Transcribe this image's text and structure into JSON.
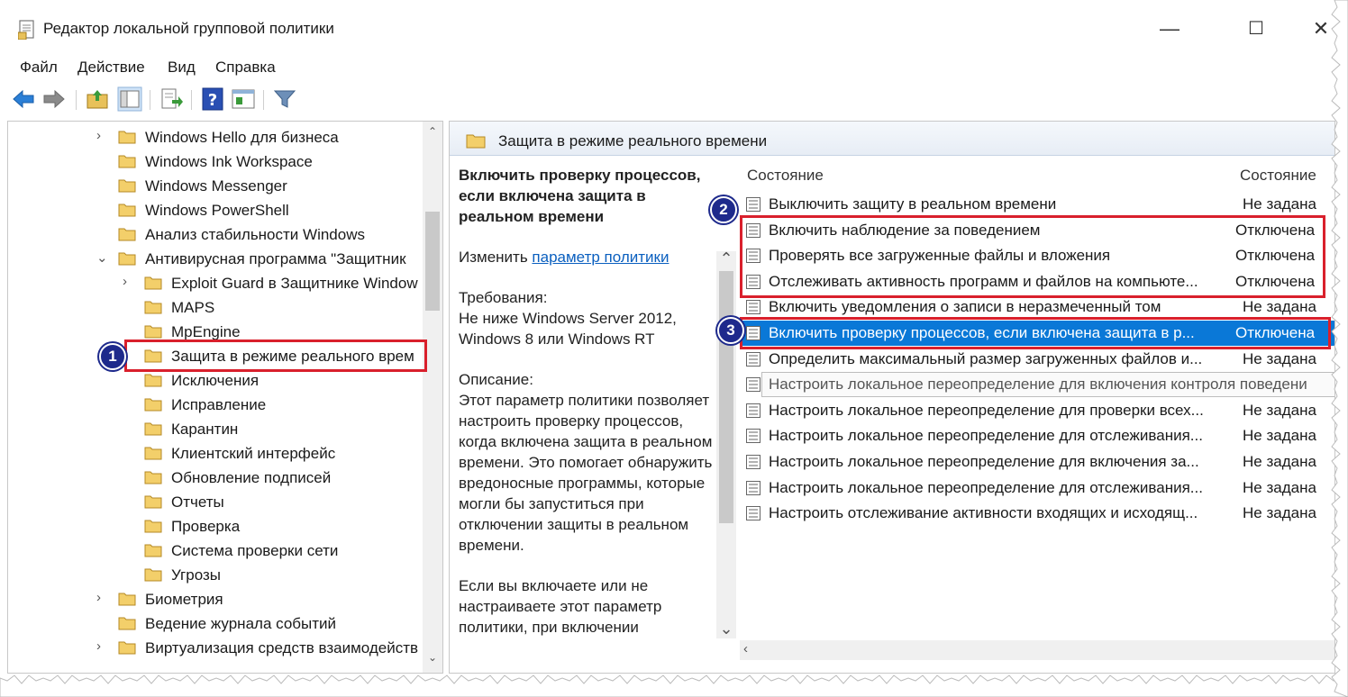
{
  "window": {
    "title": "Редактор локальной групповой политики"
  },
  "window_controls": {
    "minimize": "—",
    "maximize": "☐",
    "close": "✕"
  },
  "menu": [
    "Файл",
    "Действие",
    "Вид",
    "Справка"
  ],
  "tree": {
    "items": [
      {
        "label": "Windows Hello для бизнеса",
        "level": 0,
        "expander": "›"
      },
      {
        "label": "Windows Ink Workspace",
        "level": 0,
        "expander": ""
      },
      {
        "label": "Windows Messenger",
        "level": 0,
        "expander": ""
      },
      {
        "label": "Windows PowerShell",
        "level": 0,
        "expander": ""
      },
      {
        "label": "Анализ стабильности Windows",
        "level": 0,
        "expander": ""
      },
      {
        "label": "Антивирусная программа \"Защитник",
        "level": 0,
        "expander": "⌄"
      },
      {
        "label": "Exploit Guard в Защитнике Window",
        "level": 1,
        "expander": "›"
      },
      {
        "label": "MAPS",
        "level": 1,
        "expander": ""
      },
      {
        "label": "MpEngine",
        "level": 1,
        "expander": ""
      },
      {
        "label": "Защита в режиме реального врем",
        "level": 1,
        "expander": "",
        "selected": true
      },
      {
        "label": "Исключения",
        "level": 1,
        "expander": ""
      },
      {
        "label": "Исправление",
        "level": 1,
        "expander": ""
      },
      {
        "label": "Карантин",
        "level": 1,
        "expander": ""
      },
      {
        "label": "Клиентский интерфейс",
        "level": 1,
        "expander": ""
      },
      {
        "label": "Обновление подписей",
        "level": 1,
        "expander": ""
      },
      {
        "label": "Отчеты",
        "level": 1,
        "expander": ""
      },
      {
        "label": "Проверка",
        "level": 1,
        "expander": ""
      },
      {
        "label": "Система проверки сети",
        "level": 1,
        "expander": ""
      },
      {
        "label": "Угрозы",
        "level": 1,
        "expander": ""
      },
      {
        "label": "Биометрия",
        "level": 0,
        "expander": "›"
      },
      {
        "label": "Ведение журнала событий",
        "level": 0,
        "expander": ""
      },
      {
        "label": "Виртуализация средств взаимодейств",
        "level": 0,
        "expander": "›"
      }
    ]
  },
  "pane_header": {
    "title": "Защита в режиме реального времени"
  },
  "description": {
    "heading": "Включить проверку процессов, если включена защита в реальном времени",
    "edit_prefix": "Изменить",
    "edit_link": "параметр политики",
    "requirements_label": "Требования:",
    "requirements_text": "Не ниже Windows Server 2012, Windows 8 или Windows RT",
    "description_label": "Описание:",
    "description_text": "Этот параметр политики позволяет настроить проверку процессов, когда включена защита в реальном времени. Это помогает обнаружить вредоносные программы, которые могли бы запуститься при отключении защиты в реальном времени.",
    "extra_text": "Если вы включаете или не настраиваете этот параметр политики, при включении"
  },
  "list": {
    "col_name": "Состояние",
    "col_state": "Состояние",
    "rows": [
      {
        "name": "Выключить защиту в реальном времени",
        "state": "Не задана"
      },
      {
        "name": "Включить наблюдение за поведением",
        "state": "Отключена"
      },
      {
        "name": "Проверять все загруженные файлы и вложения",
        "state": "Отключена"
      },
      {
        "name": "Отслеживать активность программ и файлов на компьюте...",
        "state": "Отключена"
      },
      {
        "name": "Включить уведомления о записи в неразмеченный том",
        "state": "Не задана"
      },
      {
        "name": "Включить проверку процессов, если включена защита в р...",
        "state": "Отключена",
        "selected": true
      },
      {
        "name": "Определить максимальный размер загруженных файлов и...",
        "state": "Не задана"
      },
      {
        "name": "Настроить локальное переопределение для включения контроля поведени",
        "state": "",
        "tooltip": true
      },
      {
        "name": "Настроить локальное переопределение для проверки всех...",
        "state": "Не задана"
      },
      {
        "name": "Настроить локальное переопределение для отслеживания...",
        "state": "Не задана"
      },
      {
        "name": "Настроить локальное переопределение для включения за...",
        "state": "Не задана"
      },
      {
        "name": "Настроить локальное переопределение для отслеживания...",
        "state": "Не задана"
      },
      {
        "name": "Настроить отслеживание активности входящих и исходящ...",
        "state": "Не задана"
      }
    ]
  },
  "badges": [
    "1",
    "2",
    "3"
  ],
  "colors": {
    "highlight": "#d9202c",
    "badge": "#1e2a8c",
    "selection": "#0a78d7",
    "link": "#0a5fbf"
  },
  "icons": [
    "back-arrow-icon",
    "forward-arrow-icon",
    "up-folder-icon",
    "show-hide-tree-icon",
    "export-list-icon",
    "help-icon",
    "properties-icon",
    "filter-icon",
    "folder-icon",
    "policy-setting-icon"
  ]
}
